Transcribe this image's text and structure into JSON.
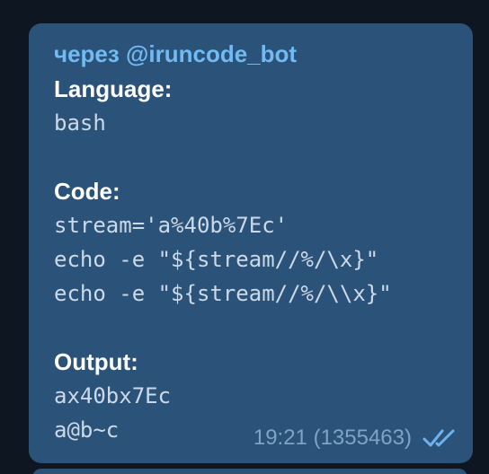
{
  "message": {
    "via": "через @iruncode_bot",
    "language_label": "Language:",
    "language_value": "bash",
    "code_label": "Code:",
    "code_lines": [
      "stream='a%40b%7Ec'",
      "echo -e \"${stream//%/\\x}\"",
      "echo -e \"${stream//%/\\\\x}\""
    ],
    "output_label": "Output:",
    "output_lines": [
      "ax40bx7Ec",
      "a@b~c"
    ],
    "time": "19:21 (1355463)",
    "status_icon": "double-check-icon"
  },
  "colors": {
    "background": "#0e1621",
    "bubble": "#2b5278",
    "via": "#71baf2",
    "label": "#ffffff",
    "code": "#ccd9e8",
    "meta": "#7ea3c6",
    "check": "#6fb2ee"
  }
}
